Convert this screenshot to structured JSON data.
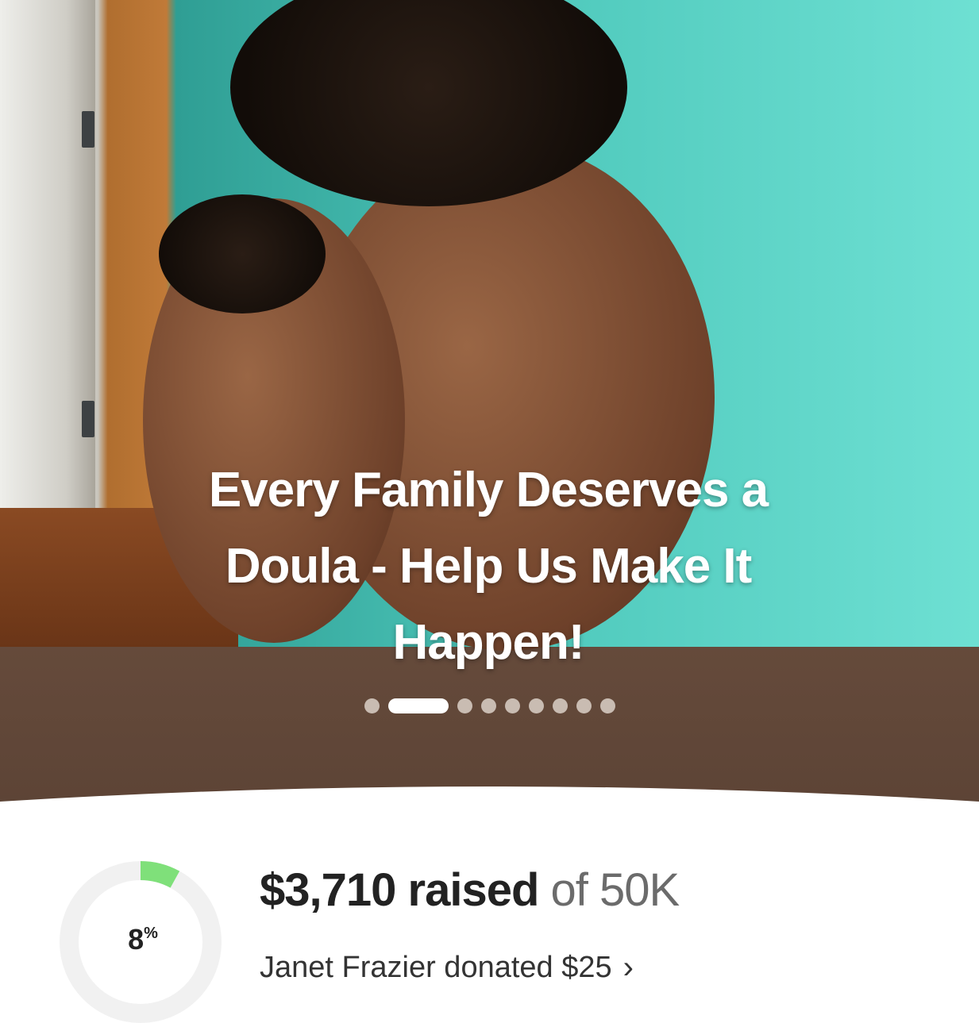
{
  "campaign": {
    "title_lines": [
      "Every Family Deserves a",
      "Doula - Help Us Make It",
      "Happen!"
    ]
  },
  "carousel": {
    "slide_count": 9,
    "active_index": 1
  },
  "progress": {
    "percent": 8,
    "percent_label": "8",
    "percent_sign": "%",
    "raised_amount": "$3,710 raised",
    "goal_text": "of 50K"
  },
  "recent_donation": {
    "text": "Janet Frazier donated $25",
    "chevron": "›"
  },
  "colors": {
    "progress_fill": "#7fe07a",
    "progress_track": "#f1f1f1",
    "hero_bottom": "#6e5140"
  }
}
